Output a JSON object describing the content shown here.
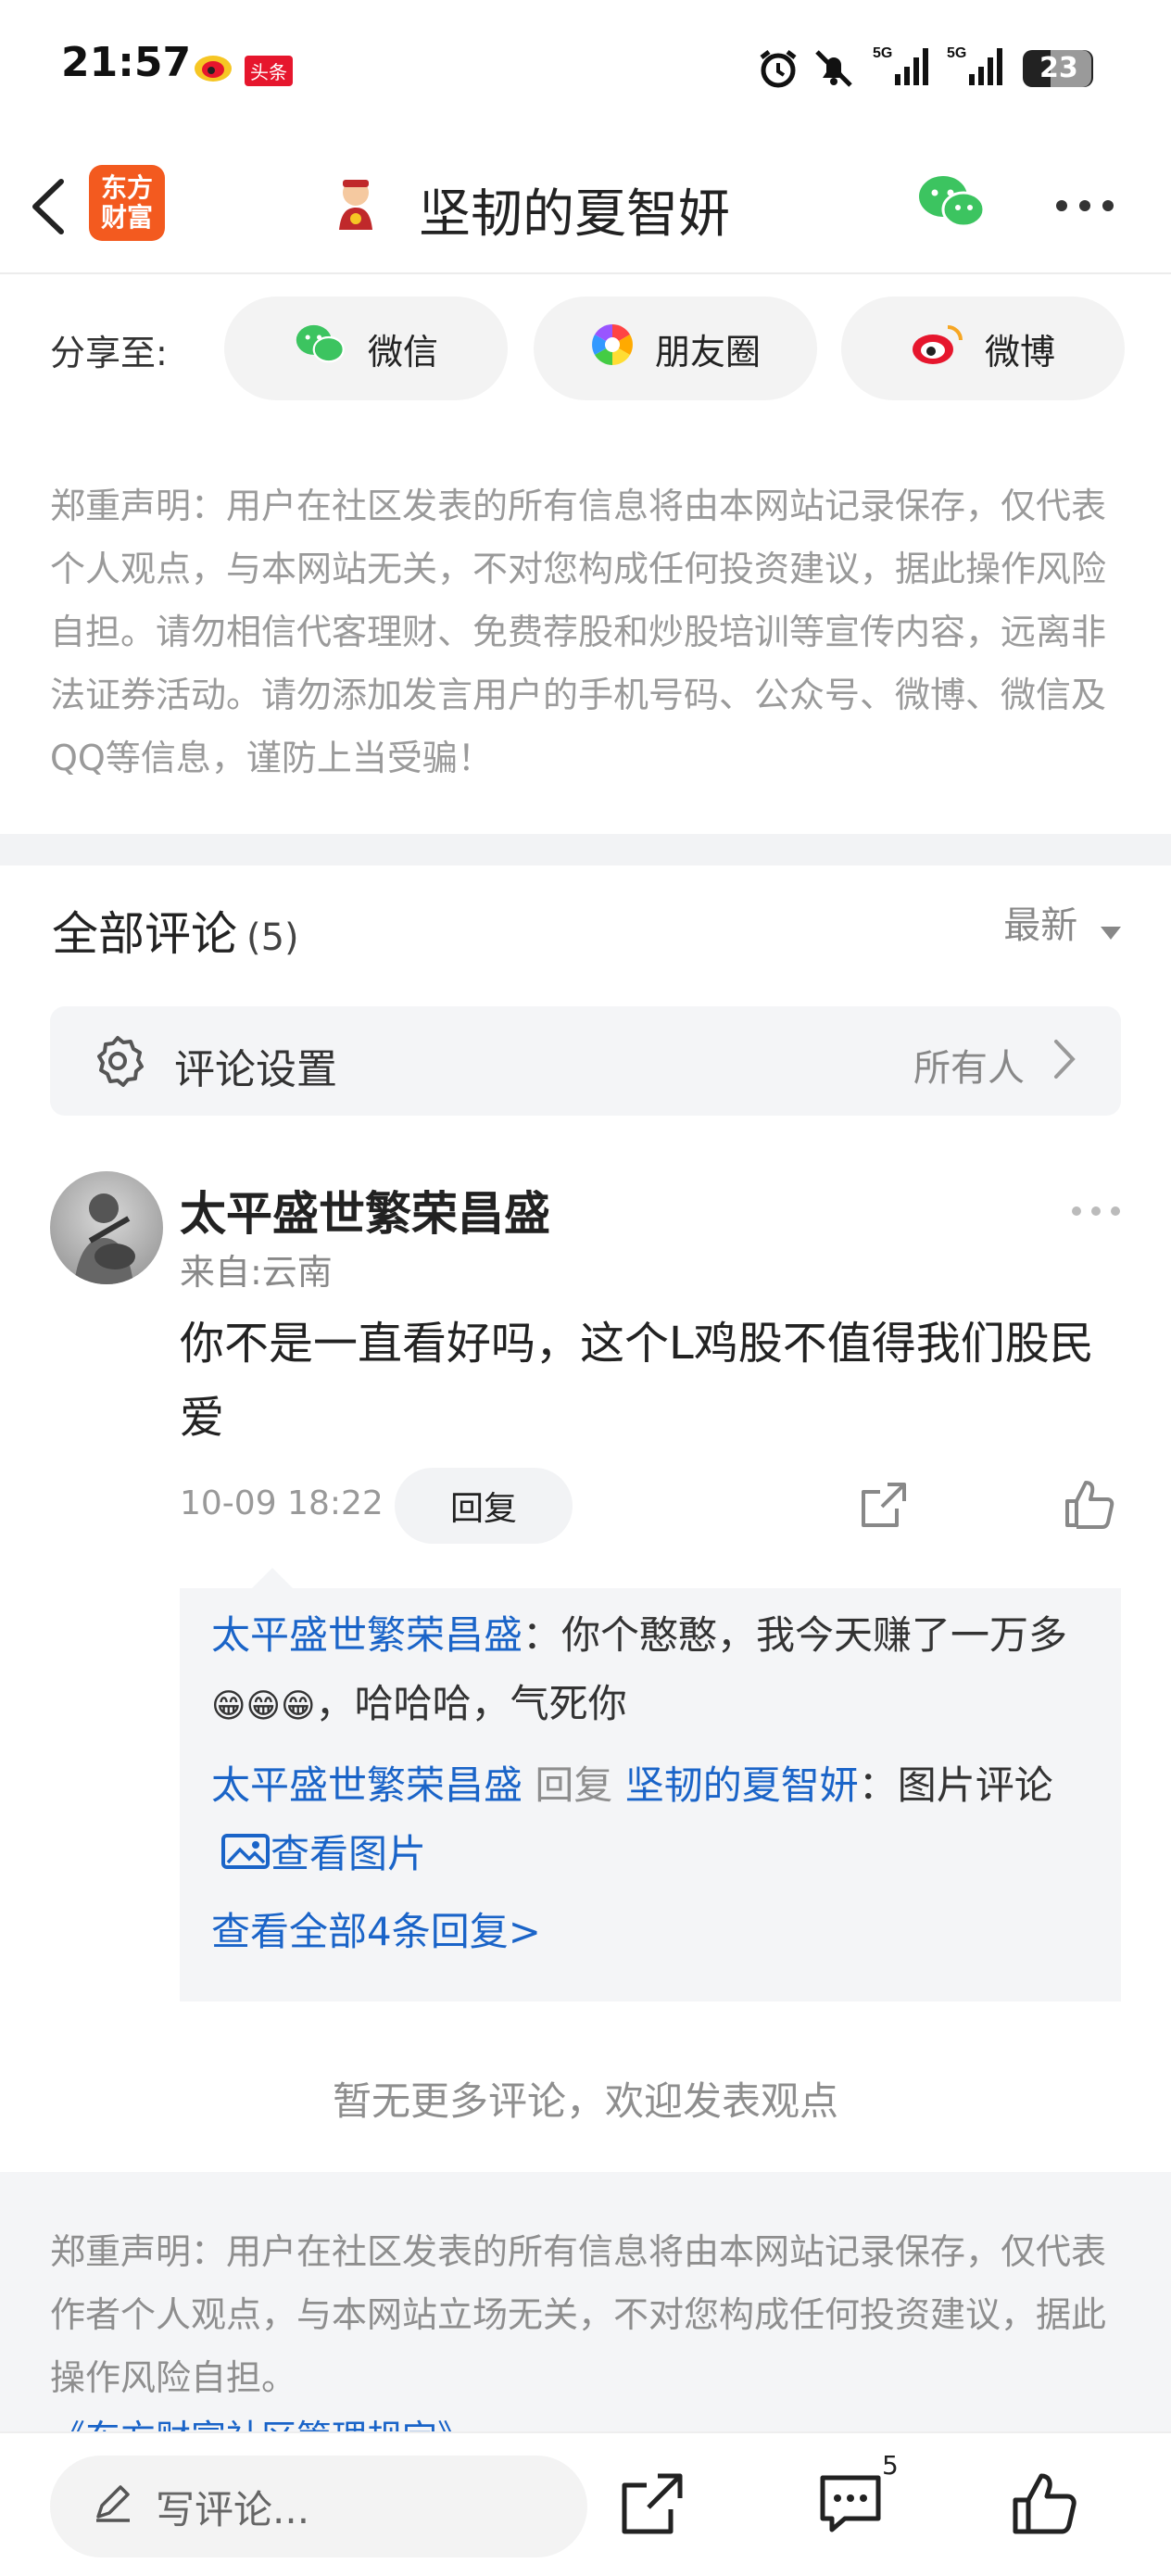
{
  "status_bar": {
    "time": "21:57",
    "app_badge": "头条",
    "network_1": "5G",
    "network_2": "5G",
    "battery": "23"
  },
  "navbar": {
    "logo_line1": "东方",
    "logo_line2": "财富",
    "title": "坚韧的夏智妍"
  },
  "share": {
    "label": "分享至:",
    "wechat": "微信",
    "moments": "朋友圈",
    "weibo": "微博"
  },
  "disclaimer_top": "郑重声明：用户在社区发表的所有信息将由本网站记录保存，仅代表个人观点，与本网站无关，不对您构成任何投资建议，据此操作风险自担。请勿相信代客理财、免费荐股和炒股培训等宣传内容，远离非法证券活动。请勿添加发言用户的手机号码、公众号、微博、微信及QQ等信息，谨防上当受骗！",
  "comments_header": {
    "title": "全部评论",
    "count": "(5)",
    "sort": "最新"
  },
  "comment_settings": {
    "label": "评论设置",
    "value": "所有人"
  },
  "comment": {
    "username": "太平盛世繁荣昌盛",
    "from": "来自:云南",
    "text": "你不是一直看好吗，这个L鸡股不值得我们股民爱",
    "time": "10-09 18:22",
    "reply_label": "回复"
  },
  "replies": {
    "r1_user": "太平盛世繁荣昌盛",
    "r1_text_a": "：你个憨憨，我今天赚了一万多",
    "r1_emoji": "😁😁😁",
    "r1_text_b": "，哈哈哈，气死你",
    "r2_user": "太平盛世繁荣昌盛",
    "r2_reply_word": "回复",
    "r2_target": "坚韧的夏智妍",
    "r2_text": "：图片评论",
    "r2_view_image": "查看图片",
    "view_all": "查看全部4条回复>"
  },
  "no_more": "暂无更多评论，欢迎发表观点",
  "footer": {
    "text": "郑重声明：用户在社区发表的所有信息将由本网站记录保存，仅代表作者个人观点，与本网站立场无关，不对您构成任何投资建议，据此操作风险自担。",
    "link": "《东方财富社区管理规定》"
  },
  "bottom_bar": {
    "input_placeholder": "写评论...",
    "comment_count": "5"
  },
  "colors": {
    "link_blue": "#1a64c8",
    "logo_orange": "#f35a1f",
    "wechat_green": "#3cc460",
    "weibo_red": "#e6162d"
  }
}
